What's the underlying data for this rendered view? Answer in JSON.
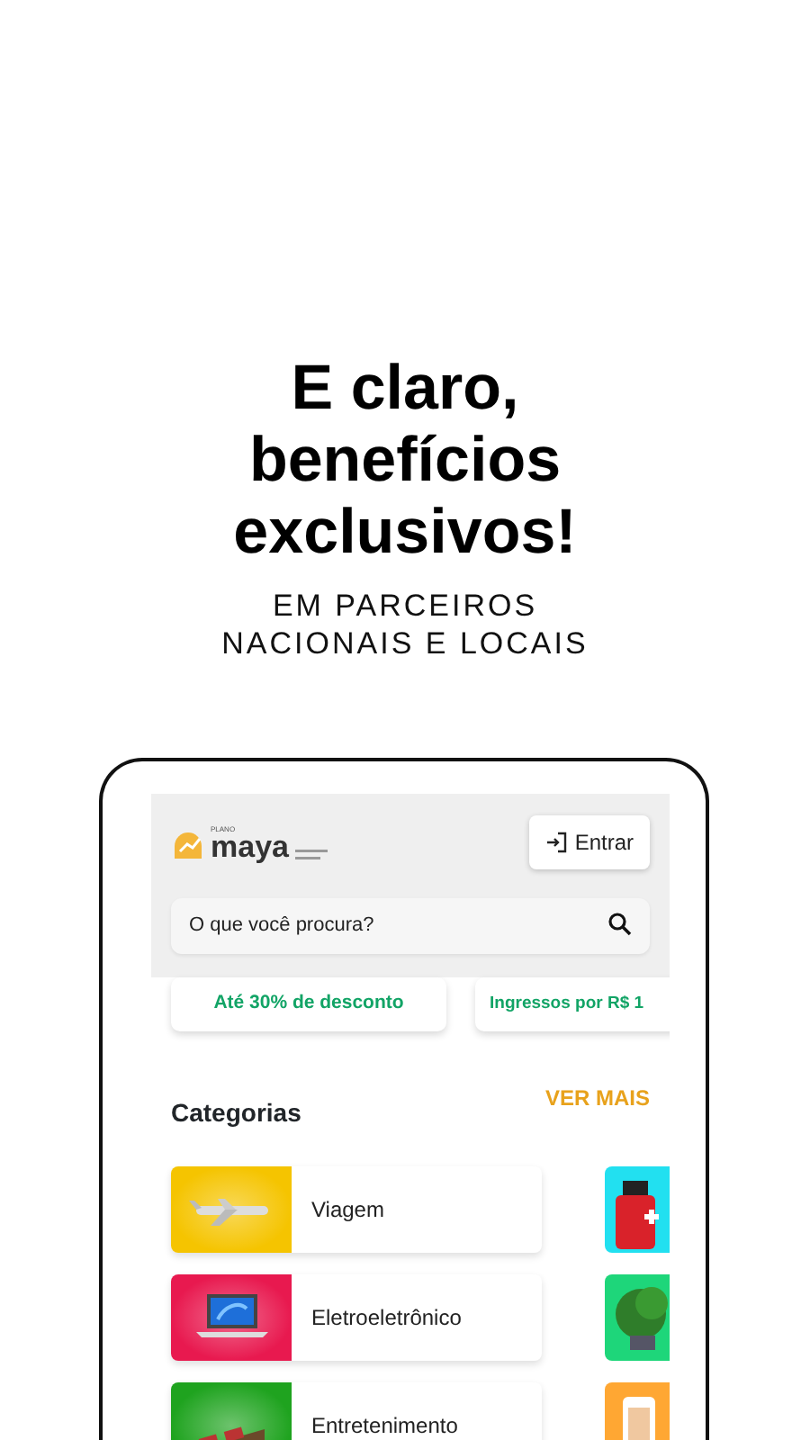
{
  "headline": {
    "lines": [
      "E claro,",
      "benefícios",
      "exclusivos!"
    ]
  },
  "subtitle": {
    "lines": [
      "EM PARCEIROS",
      "NACIONAIS E LOCAIS"
    ]
  },
  "app": {
    "logo": {
      "small": "PLANO",
      "name": "maya"
    },
    "login_button": "Entrar",
    "search": {
      "placeholder": "O que você procura?"
    },
    "promos": [
      "Até 30% de desconto",
      "Ingressos por R$ 1"
    ],
    "categories_title": "Categorias",
    "see_more": "VER MAIS",
    "categories": [
      {
        "label": "Viagem"
      },
      {
        "label": "Eletroeletrônico"
      },
      {
        "label": "Entretenimento"
      }
    ],
    "categories_right": [
      {
        "kind": "picture"
      },
      {
        "kind": "picture"
      },
      {
        "kind": "picture"
      }
    ]
  }
}
